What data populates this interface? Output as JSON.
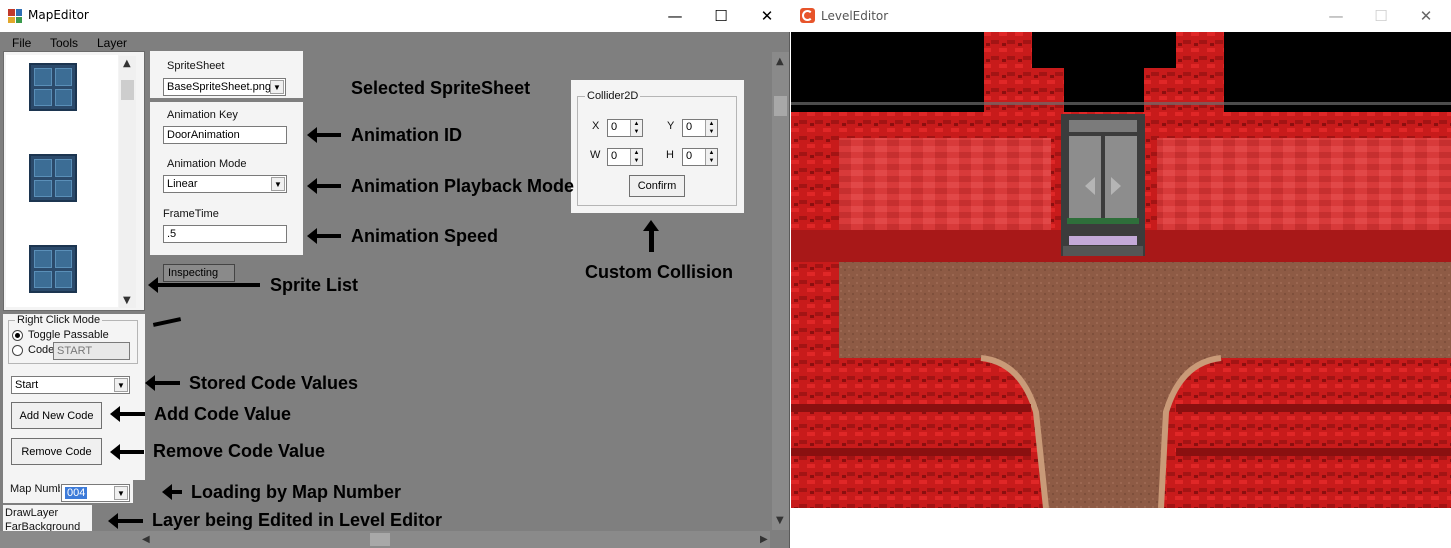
{
  "map_editor": {
    "title": "MapEditor",
    "window_controls": {
      "minimize": "—",
      "maximize": "☐",
      "close": "✕"
    },
    "menu": [
      "File",
      "Tools",
      "Layer"
    ],
    "spritesheet": {
      "label": "SpriteSheet",
      "value": "BaseSpriteSheet.png"
    },
    "animation_key": {
      "label": "Animation Key",
      "value": "DoorAnimation"
    },
    "animation_mode": {
      "label": "Animation Mode",
      "value": "Linear"
    },
    "frame_time": {
      "label": "FrameTime",
      "value": ".5"
    },
    "inspecting_label": "Inspecting",
    "collider": {
      "title": "Collider2D",
      "x_label": "X",
      "x_value": "0",
      "y_label": "Y",
      "y_value": "0",
      "w_label": "W",
      "w_value": "0",
      "h_label": "H",
      "h_value": "0",
      "confirm_label": "Confirm"
    },
    "right_click_mode": {
      "title": "Right Click Mode",
      "option_toggle": "Toggle Passable",
      "option_code": "Code",
      "code_value": "START"
    },
    "stored_code": {
      "value": "Start"
    },
    "add_code_label": "Add New Code",
    "remove_code_label": "Remove Code",
    "map_number": {
      "label": "Map Numb",
      "value": "004"
    },
    "layer_info": {
      "line1": "DrawLayer",
      "line2": "FarBackground"
    }
  },
  "annotations": {
    "selected_spritesheet": "Selected SpriteSheet",
    "animation_id": "Animation ID",
    "animation_playback_mode": "Animation Playback Mode",
    "animation_speed": "Animation Speed",
    "sprite_list": "Sprite List",
    "custom_collision": "Custom Collision",
    "stored_code_values": "Stored Code Values",
    "add_code_value": "Add Code Value",
    "remove_code_value": "Remove Code Value",
    "loading_by_map_number": "Loading by Map Number",
    "layer_being_edited": "Layer being Edited in Level Editor"
  },
  "level_editor": {
    "title": "LevelEditor",
    "window_controls": {
      "minimize": "—",
      "maximize": "☐",
      "close": "✕"
    }
  },
  "colors": {
    "editor_bg": "#7f7f7f",
    "panel_bg": "#f4f4f4",
    "rock_red": "#d11f1f",
    "rock_dark": "#7a0d0d",
    "floor_brown": "#8e5b45"
  }
}
